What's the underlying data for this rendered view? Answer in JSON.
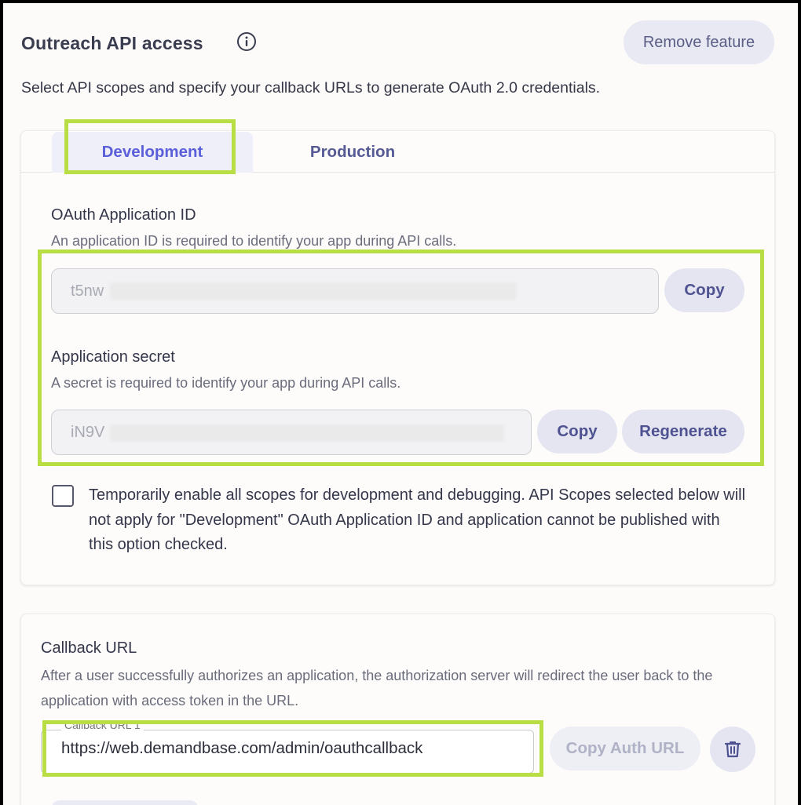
{
  "header": {
    "title": "Outreach API access",
    "info_icon": "info-icon",
    "remove_label": "Remove feature",
    "subtitle": "Select API scopes and specify your callback URLs to generate OAuth 2.0 credentials."
  },
  "tabs": [
    {
      "label": "Development",
      "active": true
    },
    {
      "label": "Production",
      "active": false
    }
  ],
  "oauth": {
    "label": "OAuth Application ID",
    "help": "An application ID is required to identify your app during API calls.",
    "value": "t5nw",
    "copy_label": "Copy"
  },
  "secret": {
    "label": "Application secret",
    "help": "A secret is required to identify your app during API calls.",
    "value": "iN9V",
    "copy_label": "Copy",
    "regenerate_label": "Regenerate"
  },
  "debug_checkbox": {
    "checked": false,
    "text": "Temporarily enable all scopes for development and debugging. API Scopes selected below will not apply for \"Development\" OAuth Application ID and application cannot be published with this option checked."
  },
  "callback": {
    "label": "Callback URL",
    "help": "After a user successfully authorizes an application, the authorization server will redirect the user back to the application with access token in the URL.",
    "field_label": "Callback URL 1",
    "value": "https://web.demandbase.com/admin/oauthcallback",
    "copy_auth_label": "Copy Auth URL",
    "delete_icon": "trash-icon"
  },
  "colors": {
    "highlight": "#b9de45",
    "tab_active": "#5b5fd9",
    "button_bg": "#e4e5f1"
  }
}
